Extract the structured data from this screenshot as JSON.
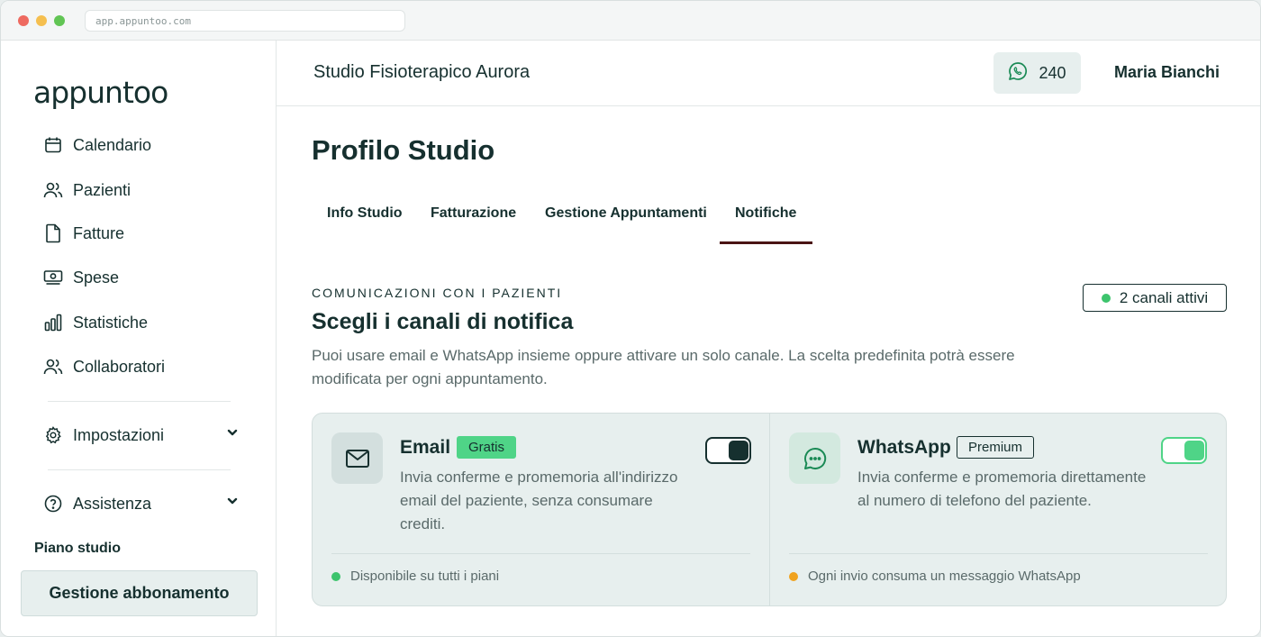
{
  "browser": {
    "url": "app.appuntoo.com"
  },
  "sidebar": {
    "logo": "appuntoo",
    "items": [
      {
        "label": "Calendario",
        "icon": "calendar-icon"
      },
      {
        "label": "Pazienti",
        "icon": "users-icon"
      },
      {
        "label": "Fatture",
        "icon": "document-icon"
      },
      {
        "label": "Spese",
        "icon": "banknote-icon"
      },
      {
        "label": "Statistiche",
        "icon": "bar-chart-icon"
      },
      {
        "label": "Collaboratori",
        "icon": "users-icon"
      }
    ],
    "settings": {
      "label": "Impostazioni",
      "icon": "gear-icon"
    },
    "help": {
      "label": "Assistenza",
      "icon": "help-icon"
    },
    "plan_title": "Piano studio",
    "plan_button": "Gestione abbonamento"
  },
  "header": {
    "studio_name": "Studio Fisioterapico Aurora",
    "whatsapp_credits": "240",
    "user_name": "Maria Bianchi"
  },
  "page": {
    "title": "Profilo Studio",
    "tabs": [
      {
        "label": "Info Studio",
        "active": false
      },
      {
        "label": "Fatturazione",
        "active": false
      },
      {
        "label": "Gestione Appuntamenti",
        "active": false
      },
      {
        "label": "Notifiche",
        "active": true
      }
    ]
  },
  "section": {
    "eyebrow": "COMUNICAZIONI CON I PAZIENTI",
    "title": "Scegli i canali di notifica",
    "description": "Puoi usare email e WhatsApp insieme oppure attivare un solo canale. La scelta predefinita potrà essere modificata per ogni appuntamento.",
    "active_badge": "2 canali attivi"
  },
  "channels": [
    {
      "name": "Email",
      "badge": "Gratis",
      "description": "Invia conferme e promemoria all'indirizzo email del paziente, senza consumare crediti.",
      "enabled": true,
      "footnote": "Disponibile su tutti i piani",
      "footnote_color": "#3dc46d"
    },
    {
      "name": "WhatsApp",
      "badge": "Premium",
      "description": "Invia conferme e promemoria direttamente al numero di telefono del paziente.",
      "enabled": true,
      "footnote": "Ogni invio consuma un messaggio WhatsApp",
      "footnote_color": "#f0a21e"
    }
  ],
  "colors": {
    "primary": "#16302f",
    "accent_green": "#4fd487",
    "tab_underline": "#4a1414"
  }
}
